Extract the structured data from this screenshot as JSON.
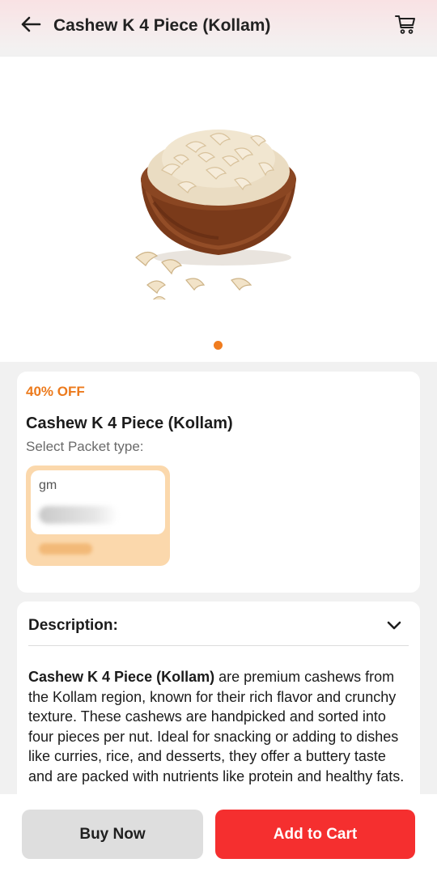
{
  "header": {
    "title": "Cashew K 4 Piece (Kollam)",
    "back_icon": "arrow-left-icon",
    "cart_icon": "cart-icon"
  },
  "gallery": {
    "image_alt": "Cashew nuts in a wooden bowl",
    "active_dot_color": "#f07c1f",
    "slide_count": 1,
    "active_index": 0
  },
  "product": {
    "discount": "40% OFF",
    "name": "Cashew K 4 Piece (Kollam)",
    "select_label": "Select Packet type:",
    "packet_options": [
      {
        "unit": "gm",
        "selected": true
      }
    ]
  },
  "description": {
    "title": "Description:",
    "chevron_icon": "chevron-down-icon",
    "bold_lead": "Cashew K 4 Piece (Kollam)",
    "body": " are premium cashews from the Kollam region, known for their rich flavor and crunchy texture. These cashews are handpicked and sorted into four pieces per nut. Ideal for snacking or adding to dishes like curries, rice, and desserts, they offer a buttery taste and are packed with nutrients like protein and healthy fats."
  },
  "actions": {
    "buy_now_label": "Buy Now",
    "add_to_cart_label": "Add to Cart",
    "add_to_cart_color": "#f52f2f",
    "buy_now_color": "#dedede"
  },
  "colors": {
    "accent_orange": "#ec7a1c",
    "packet_selected_bg": "#fbd8ac"
  }
}
